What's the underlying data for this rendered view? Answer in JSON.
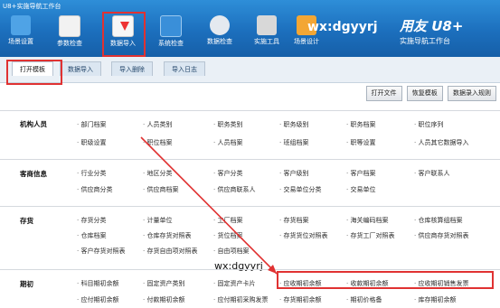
{
  "app_title": "U8+实施导航工作台",
  "ribbon_buttons": [
    {
      "label": "场景设置",
      "icon": "scene-settings-icon"
    },
    {
      "label": "参数检查",
      "icon": "parameter-check-icon"
    },
    {
      "label": "数据导入",
      "icon": "data-import-icon"
    },
    {
      "label": "系统检查",
      "icon": "system-check-icon"
    },
    {
      "label": "数据检查",
      "icon": "data-check-icon"
    },
    {
      "label": "实施工具",
      "icon": "tools-icon"
    },
    {
      "label": "场景设计",
      "icon": "scene-design-icon"
    }
  ],
  "brand_text": "wx:dgyyrj",
  "logo": {
    "line1": "用友 U8+",
    "line2": "实施导航工作台"
  },
  "tabs": [
    "打开模板",
    "数据导入",
    "导入删除",
    "导入日志"
  ],
  "toolbar": [
    "打开文件",
    "恢复模板",
    "数据录入规则"
  ],
  "sections": [
    {
      "title": "机构人员",
      "rows": [
        [
          "部门档案",
          "人员类别",
          "职务类别",
          "职务级别",
          "职务档案",
          "职位序列"
        ],
        [
          "职级设置",
          "职位档案",
          "人员档案",
          "班组档案",
          "职等设置",
          "人员其它数据导入"
        ]
      ]
    },
    {
      "title": "客商信息",
      "rows": [
        [
          "行业分类",
          "地区分类",
          "客户分类",
          "客户级别",
          "客户档案",
          "客户联系人"
        ],
        [
          "供应商分类",
          "供应商档案",
          "供应商联系人",
          "交易单位分类",
          "交易单位"
        ]
      ]
    },
    {
      "title": "存货",
      "rows": [
        [
          "存货分类",
          "计量单位",
          "工厂档案",
          "存货档案",
          "海关编码档案",
          "仓库核算组档案"
        ],
        [
          "仓库档案",
          "仓库存货对照表",
          "货位档案",
          "存货货位对照表",
          "存货工厂对照表",
          "供应商存货对照表"
        ],
        [
          "客户存货对照表",
          "存货自由项对照表",
          "自由项档案"
        ]
      ]
    },
    {
      "title": "期初",
      "rows": [
        [
          "科目期初余额",
          "固定资产类别",
          "固定资产卡片",
          "应收期初余额",
          "收款期初余额",
          "应收期初销售发票"
        ],
        [
          "应付期初余额",
          "付款期初余额",
          "应付期初采购发票",
          "存货期初余额",
          "期初价格备",
          "库存期初余额"
        ]
      ]
    }
  ],
  "watermark": "wx:dgyyrj"
}
